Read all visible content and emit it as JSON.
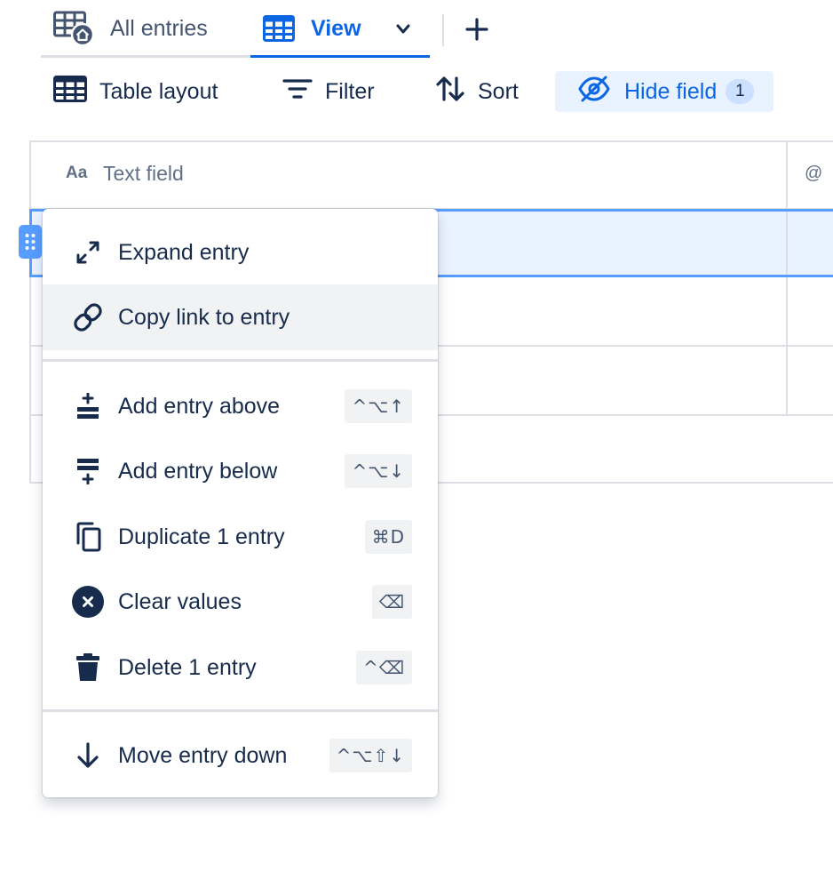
{
  "tabs": {
    "all_entries": "All entries",
    "view": "View"
  },
  "toolbar": {
    "table_layout": "Table layout",
    "filter": "Filter",
    "sort": "Sort",
    "hide_field": "Hide field",
    "hide_field_count": "1"
  },
  "table": {
    "header": {
      "type_glyph": "Aa",
      "label": "Text field",
      "next_col_glyph": "@"
    }
  },
  "context_menu": {
    "items": [
      {
        "label": "Expand entry",
        "icon": "expand-icon",
        "shortcut": ""
      },
      {
        "label": "Copy link to entry",
        "icon": "link-icon",
        "shortcut": ""
      },
      {
        "label": "Add entry above",
        "icon": "add-above-icon",
        "shortcut": "^⌥↑"
      },
      {
        "label": "Add entry below",
        "icon": "add-below-icon",
        "shortcut": "^⌥↓"
      },
      {
        "label": "Duplicate 1 entry",
        "icon": "copy-icon",
        "shortcut": "⌘D"
      },
      {
        "label": "Clear values",
        "icon": "clear-icon",
        "shortcut": "⌫"
      },
      {
        "label": "Delete 1 entry",
        "icon": "trash-icon",
        "shortcut": "^⌫"
      },
      {
        "label": "Move entry down",
        "icon": "arrow-down-icon",
        "shortcut": "^⌥⇧↓"
      }
    ]
  },
  "colors": {
    "accent": "#0c66e4",
    "accent_bg": "#e9f2ff",
    "hover_bg": "#f1f2f4",
    "text": "#172b4d",
    "subtle_text": "#626f86",
    "border": "#dcdfe4"
  }
}
